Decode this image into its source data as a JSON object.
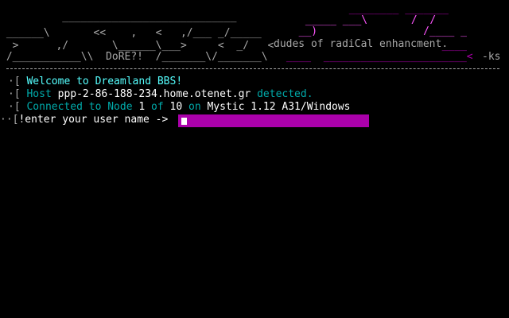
{
  "art": {
    "rows": [
      "          ____________________________                               ",
      " ______\\       <<    ,   <   ,/___ _/_____                          ",
      "  >      ,/       \\______\\___>     <  _/   <                         ",
      " /___________\\\\  DoRE?!  /_______\\/_______\\                          "
    ],
    "right_rows": [
      "       ________ _______ ",
      " _____ ___\\       /  / ",
      "  __)                 /____ _ ",
      "                         ____ ",
      " ____  _______________________<  "
    ],
    "tagline": "dudes of radiCal enhancment.",
    "signature": "-ks"
  },
  "messages": {
    "welcome": {
      "prefix": "[ ",
      "text": "Welcome to Dreamland BBS!"
    },
    "host": {
      "prefix": "[ ",
      "label": "Host ",
      "value": "ppp-2-86-188-234.home.otenet.gr",
      "suffix": " detected."
    },
    "connected": {
      "prefix": "[ ",
      "label": "Connected to Node ",
      "node": "1",
      "of": " of ",
      "total": "10",
      "on": " on ",
      "software": "Mystic 1.12 A31/Windows"
    }
  },
  "prompt": {
    "bracket": "[",
    "text": "!enter your user name ->",
    "value": ""
  },
  "colors": {
    "background": "#000000",
    "cyan": "#55ffff",
    "dark_cyan": "#00aaaa",
    "magenta": "#ff55ff",
    "dark_magenta": "#aa00aa",
    "grey": "#a8a8a8",
    "white": "#ffffff"
  }
}
